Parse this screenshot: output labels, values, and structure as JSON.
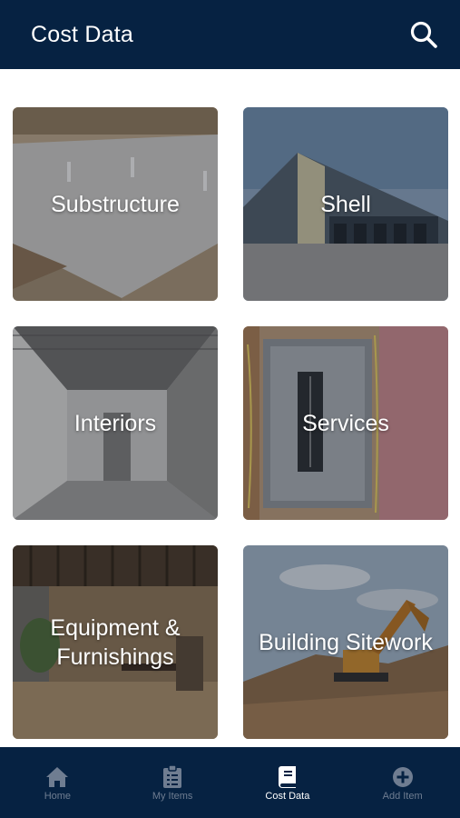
{
  "header": {
    "title": "Cost Data",
    "search_icon": "search-icon"
  },
  "tiles": [
    {
      "label": "Substructure",
      "image": "concrete-foundation-photo"
    },
    {
      "label": "Shell",
      "image": "building-exterior-photo"
    },
    {
      "label": "Interiors",
      "image": "interior-framing-photo"
    },
    {
      "label": "Services",
      "image": "electrical-panel-photo"
    },
    {
      "label": "Equipment & Furnishings",
      "image": "furnished-office-photo"
    },
    {
      "label": "Building Sitework",
      "image": "excavator-site-photo"
    }
  ],
  "tabbar": {
    "items": [
      {
        "label": "Home",
        "icon": "home-icon",
        "active": false
      },
      {
        "label": "My Items",
        "icon": "clipboard-icon",
        "active": false
      },
      {
        "label": "Cost Data",
        "icon": "book-icon",
        "active": true
      },
      {
        "label": "Add Item",
        "icon": "plus-circle-icon",
        "active": false
      }
    ]
  },
  "colors": {
    "navy": "#062242",
    "tab_inactive": "#6f7d91",
    "tab_active": "#ffffff"
  }
}
